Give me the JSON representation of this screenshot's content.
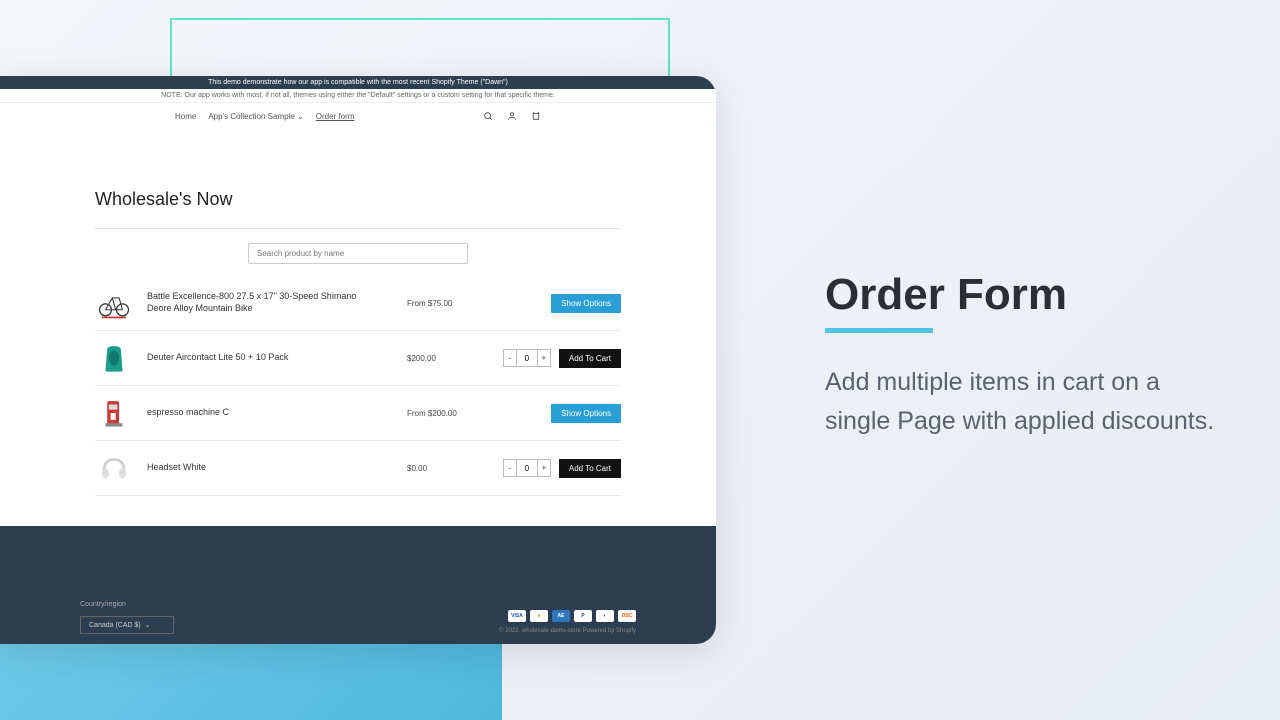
{
  "banners": {
    "top": "This demo demonstrate how our app is compatible with the most recent Shopify Theme (\"Dawn\")",
    "note": "NOTE: Our app works with most, if not all, themes using either the \"Default\" settings or a custom setting for that specific theme."
  },
  "nav": {
    "home": "Home",
    "collection": "App's Collection Sample",
    "order_form": "Order form"
  },
  "page": {
    "title": "Wholesale's Now",
    "search_placeholder": "Search product by name"
  },
  "products": [
    {
      "name": "Battle Excellence-800 27.5 x 17\" 30-Speed Shimano Deore Alloy Mountain Bike",
      "price": "From $75.00",
      "action": "options"
    },
    {
      "name": "Deuter Aircontact Lite 50 + 10 Pack",
      "price": "$200.00",
      "action": "cart",
      "qty": "0"
    },
    {
      "name": "espresso machine C",
      "price": "From $200.00",
      "action": "options"
    },
    {
      "name": "Headset White",
      "price": "$0.00",
      "action": "cart",
      "qty": "0"
    }
  ],
  "buttons": {
    "show_options": "Show Options",
    "add_to_cart": "Add To Cart",
    "minus": "-",
    "plus": "+"
  },
  "footer": {
    "region_label": "Country/region",
    "region_value": "Canada (CAD $)",
    "copyright": "© 2022, wholesale-demo-store Powered by Shopify"
  },
  "promo": {
    "title": "Order Form",
    "text": "Add multiple items in cart on a single Page with applied discounts."
  },
  "colors": {
    "accent_blue": "#2a9fd6",
    "dark": "#2c3e50",
    "teal": "#5ce6c4"
  }
}
